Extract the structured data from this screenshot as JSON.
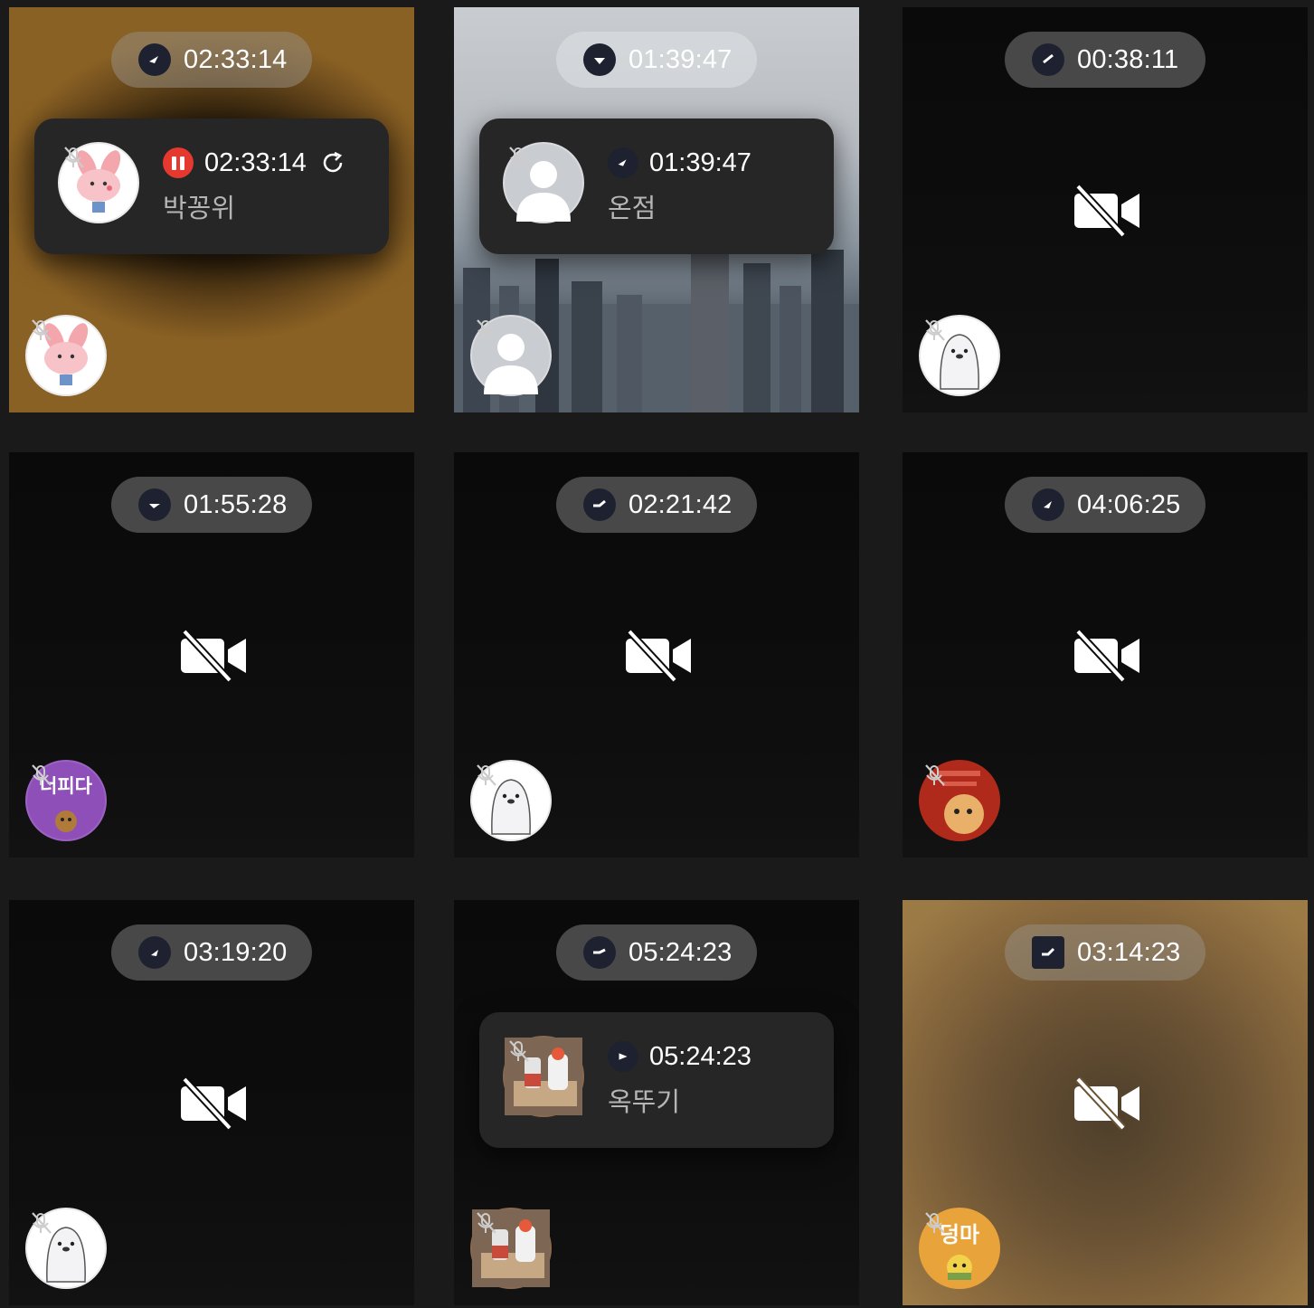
{
  "tiles": [
    {
      "id": 1,
      "timer": "02:33:14",
      "card": {
        "status": "recording",
        "time": "02:33:14",
        "name": "박꽁위"
      },
      "avatar": "rabbit-avatar",
      "camera": "on"
    },
    {
      "id": 2,
      "timer": "01:39:47",
      "card": {
        "status": "timer",
        "time": "01:39:47",
        "name": "온점"
      },
      "avatar": "default-person-avatar",
      "camera": "on"
    },
    {
      "id": 3,
      "timer": "00:38:11",
      "avatar": "seal-avatar",
      "camera": "off"
    },
    {
      "id": 4,
      "timer": "01:55:28",
      "avatar": "sticker-avatar",
      "avatar_text": "너피다",
      "camera": "off"
    },
    {
      "id": 5,
      "timer": "02:21:42",
      "avatar": "seal-avatar",
      "camera": "off"
    },
    {
      "id": 6,
      "timer": "04:06:25",
      "avatar": "sticker-avatar",
      "camera": "off"
    },
    {
      "id": 7,
      "timer": "03:19:20",
      "avatar": "seal-avatar",
      "camera": "off"
    },
    {
      "id": 8,
      "timer": "05:24:23",
      "card": {
        "status": "timer",
        "time": "05:24:23",
        "name": "옥뚜기"
      },
      "avatar": "photo-avatar",
      "camera": "on"
    },
    {
      "id": 9,
      "timer": "03:14:23",
      "avatar": "sticker-avatar",
      "avatar_text": "덩마",
      "camera": "off"
    }
  ],
  "colors": {
    "page_bg": "#1a1a1a",
    "tile_bg": "#0b0b0b",
    "card_bg": "#262626",
    "record_red": "#e5392f",
    "timer_icon_bg": "#1e2230"
  },
  "icons": {
    "timer": "stopwatch-icon",
    "recording": "pause-record-icon",
    "refresh": "refresh-icon",
    "mic_muted": "mic-muted-icon",
    "camera_off": "video-off-icon"
  }
}
